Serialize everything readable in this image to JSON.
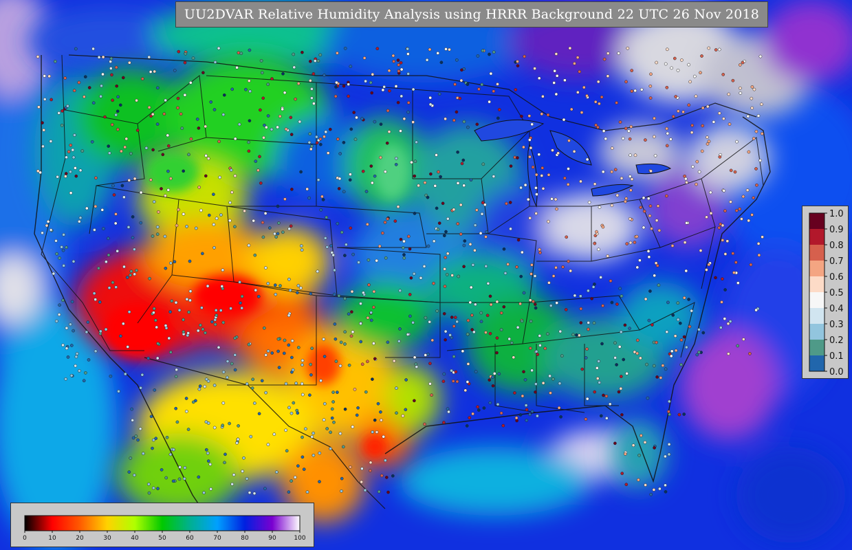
{
  "title": "UU2DVAR Relative Humidity Analysis using HRRR Background 22 UTC 26 Nov 2018",
  "colorbar_right": {
    "description_scale": "observation colors",
    "ticks": [
      "1.0",
      "0.9",
      "0.8",
      "0.7",
      "0.6",
      "0.5",
      "0.4",
      "0.3",
      "0.2",
      "0.1",
      "0.0"
    ],
    "colors": [
      "#67001f",
      "#b2182b",
      "#d6604d",
      "#f4a582",
      "#fddbc7",
      "#f7f7f7",
      "#d1e5f0",
      "#92c5de",
      "#4f9a88",
      "#2166ac",
      "#053061"
    ]
  },
  "colorbar_bottom": {
    "ticks": [
      "0",
      "10",
      "20",
      "30",
      "40",
      "50",
      "60",
      "70",
      "80",
      "90",
      "100"
    ],
    "colors": [
      "#000000",
      "#ff0000",
      "#ff5a00",
      "#ffd200",
      "#b0ff00",
      "#00c800",
      "#00b090",
      "#00a0ff",
      "#0020e0",
      "#7a00d0",
      "#ffffff"
    ]
  },
  "map": {
    "ocean_color": "#1030e0",
    "land_colors": {
      "dry": "#ee1010",
      "orange": "#ff8c00",
      "yellow": "#ffe400",
      "green": "#10c010",
      "teal": "#20a0a0",
      "blue": "#2060e0",
      "purple": "#7020c0",
      "white": "#d8d8e8"
    }
  }
}
